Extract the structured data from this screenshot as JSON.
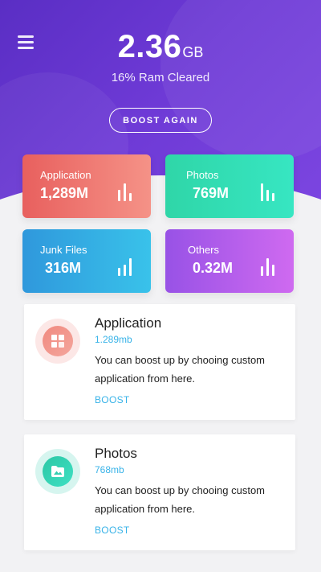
{
  "header": {
    "ram_value": "2.36",
    "ram_unit": "GB",
    "subtitle": "16% Ram Cleared",
    "boost_again_label": "BOOST AGAIN"
  },
  "tiles": [
    {
      "label": "Application",
      "value": "1,289M"
    },
    {
      "label": "Photos",
      "value": "769M"
    },
    {
      "label": "Junk Files",
      "value": "316M"
    },
    {
      "label": "Others",
      "value": "0.32M"
    }
  ],
  "cards": [
    {
      "title": "Application",
      "size": "1.289mb",
      "description": "You can boost up by chooing custom application from here.",
      "action": "BOOST",
      "icon": "grid-icon",
      "accent": "#f07c73"
    },
    {
      "title": "Photos",
      "size": "768mb",
      "description": "You can boost up by chooing custom application from here.",
      "action": "BOOST",
      "icon": "photo-folder-icon",
      "accent": "#33ceb0"
    }
  ],
  "colors": {
    "hero": "#6633cc",
    "link": "#39b3e8",
    "application": "#e8605e",
    "photos": "#2fd6a8",
    "junk": "#2f98dc",
    "others": "#9852e6"
  }
}
